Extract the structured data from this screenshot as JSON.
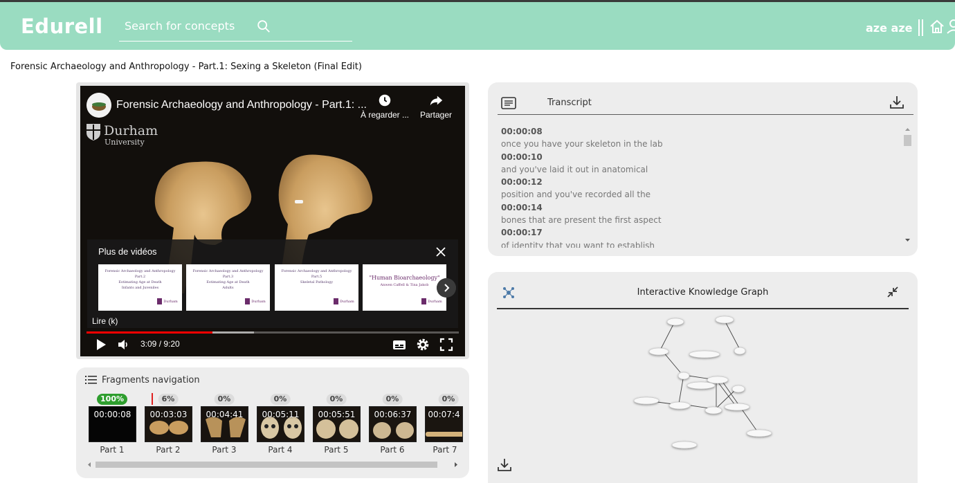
{
  "header": {
    "logo": "Edurell",
    "search_placeholder": "Search for concepts",
    "user_name": "aze aze"
  },
  "page_title": "Forensic Archaeology and Anthropology - Part.1: Sexing a Skeleton (Final Edit)",
  "video": {
    "title": "Forensic Archaeology and Anthropology - Part.1: ...",
    "watch_later": "À regarder ...",
    "share": "Partager",
    "watermark_name": "Durham",
    "watermark_univ": "University",
    "more_videos_title": "Plus de vidéos",
    "more_videos": [
      {
        "l1": "Forensic Archaeology and Anthropology",
        "l2": "Part.2",
        "l3": "Estimating Age at Death",
        "l4": "Infants and Juveniles"
      },
      {
        "l1": "Forensic Archaeology and Anthropology",
        "l2": "Part.3",
        "l3": "Estimating Age at Death",
        "l4": "Adults"
      },
      {
        "l1": "Forensic Archaeology and Anthropology",
        "l2": "Part.5",
        "l3": "Skeletal Pathology",
        "l4": ""
      },
      {
        "l1": "\"Human Bioarchaeology\"",
        "l2": "Anwen Caffell & Tina Jakob",
        "l3": "",
        "l4": ""
      }
    ],
    "thumb_crest": "Durham",
    "play_tooltip": "Lire (k)",
    "time": "3:09 / 9:20",
    "progress_fraction": 0.3375,
    "buffer_fraction": 0.45
  },
  "fragments": {
    "title": "Fragments navigation",
    "items": [
      {
        "percent": "100%",
        "time": "00:00:08",
        "label": "Part 1",
        "done": true
      },
      {
        "percent": "6%",
        "time": "00:03:03",
        "label": "Part 2",
        "done": false
      },
      {
        "percent": "0%",
        "time": "00:04:41",
        "label": "Part 3",
        "done": false
      },
      {
        "percent": "0%",
        "time": "00:05:11",
        "label": "Part 4",
        "done": false
      },
      {
        "percent": "0%",
        "time": "00:05:51",
        "label": "Part 5",
        "done": false
      },
      {
        "percent": "0%",
        "time": "00:06:37",
        "label": "Part 6",
        "done": false
      },
      {
        "percent": "0%",
        "time": "00:07:4",
        "label": "Part 7",
        "done": false
      }
    ]
  },
  "transcript": {
    "title": "Transcript",
    "entries": [
      {
        "time": "00:00:08",
        "text": "once you have your skeleton in the lab"
      },
      {
        "time": "00:00:10",
        "text": "and you've laid it out in anatomical"
      },
      {
        "time": "00:00:12",
        "text": "position and you've recorded all the"
      },
      {
        "time": "00:00:14",
        "text": "bones that are present the first aspect"
      },
      {
        "time": "00:00:17",
        "text": "of identity that you want to establish"
      }
    ]
  },
  "graph": {
    "title": "Interactive Knowledge Graph"
  },
  "colors": {
    "header_bg": "#9adcc1",
    "panel_bg": "#ededed",
    "progress_red": "#ff0000",
    "done_green": "#2e9e2e"
  }
}
